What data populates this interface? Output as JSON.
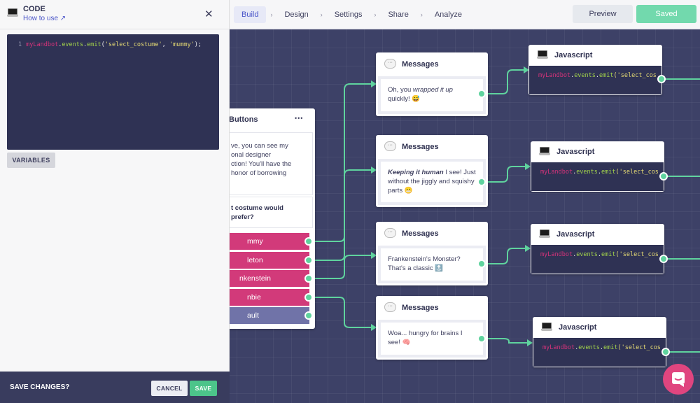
{
  "topbar": {
    "tabs": [
      {
        "label": "Build",
        "active": true
      },
      {
        "label": "Design"
      },
      {
        "label": "Settings"
      },
      {
        "label": "Share"
      },
      {
        "label": "Analyze"
      }
    ],
    "separator": "›",
    "preview_label": "Preview",
    "saved_label": "Saved"
  },
  "panel": {
    "icon": "laptop-icon",
    "title": "CODE",
    "how_to_use": "How to use ↗",
    "close": "✕",
    "code": {
      "line_number": "1",
      "obj": "myLandbot",
      "dot1": ".",
      "events": "events",
      "dot2": ".",
      "emit": "emit",
      "open": "(",
      "arg1": "'select_costume'",
      "comma": ", ",
      "arg2": "'mummy'",
      "close": ");"
    },
    "variables_label": "VARIABLES",
    "footer": {
      "question": "SAVE CHANGES?",
      "cancel": "CANCEL",
      "save": "SAVE"
    }
  },
  "buttons_node": {
    "title": "Buttons",
    "menu": "•••",
    "message": "ve, you can see my\nonal designer\nction! You'll have the\nhonor of borrowing",
    "question": "t costume would\nprefer?",
    "options": [
      "mmy",
      "leton",
      "nkenstein",
      "nbie",
      "ault"
    ]
  },
  "message_nodes": [
    {
      "title": "Messages",
      "html": "Oh, you <i>wrapped it up</i> quickly! 😅"
    },
    {
      "title": "Messages",
      "html": "<b><i>Keeping it human</i></b> I see! Just without the jiggly and squishy parts 😬"
    },
    {
      "title": "Messages",
      "html": "Frankenstein's Monster? That's a classic 🔝"
    },
    {
      "title": "Messages",
      "html": "Woa... hungry for brains I see! 🧠"
    }
  ],
  "js_nodes": [
    {
      "title": "Javascript",
      "code_obj": "myLandbot",
      "code_rest1": ".",
      "code_events": "events",
      "code_rest2": ".",
      "code_emit": "emit",
      "code_tail": "('select_cos"
    },
    {
      "title": "Javascript",
      "code_obj": "myLandbot",
      "code_rest1": ".",
      "code_events": "events",
      "code_rest2": ".",
      "code_emit": "emit",
      "code_tail": "('select_cos"
    },
    {
      "title": "Javascript",
      "code_obj": "myLandbot",
      "code_rest1": ".",
      "code_events": "events",
      "code_rest2": ".",
      "code_emit": "emit",
      "code_tail": "('select_cos"
    },
    {
      "title": "Javascript",
      "code_obj": "myLandbot",
      "code_rest1": ".",
      "code_events": "events",
      "code_rest2": ".",
      "code_emit": "emit",
      "code_tail": "('select_cos"
    }
  ],
  "colors": {
    "accent": "#4a55c9",
    "connector": "#5fd39e",
    "button": "#d23a7a",
    "default_button": "#7073a8",
    "fab": "#e0457f"
  }
}
